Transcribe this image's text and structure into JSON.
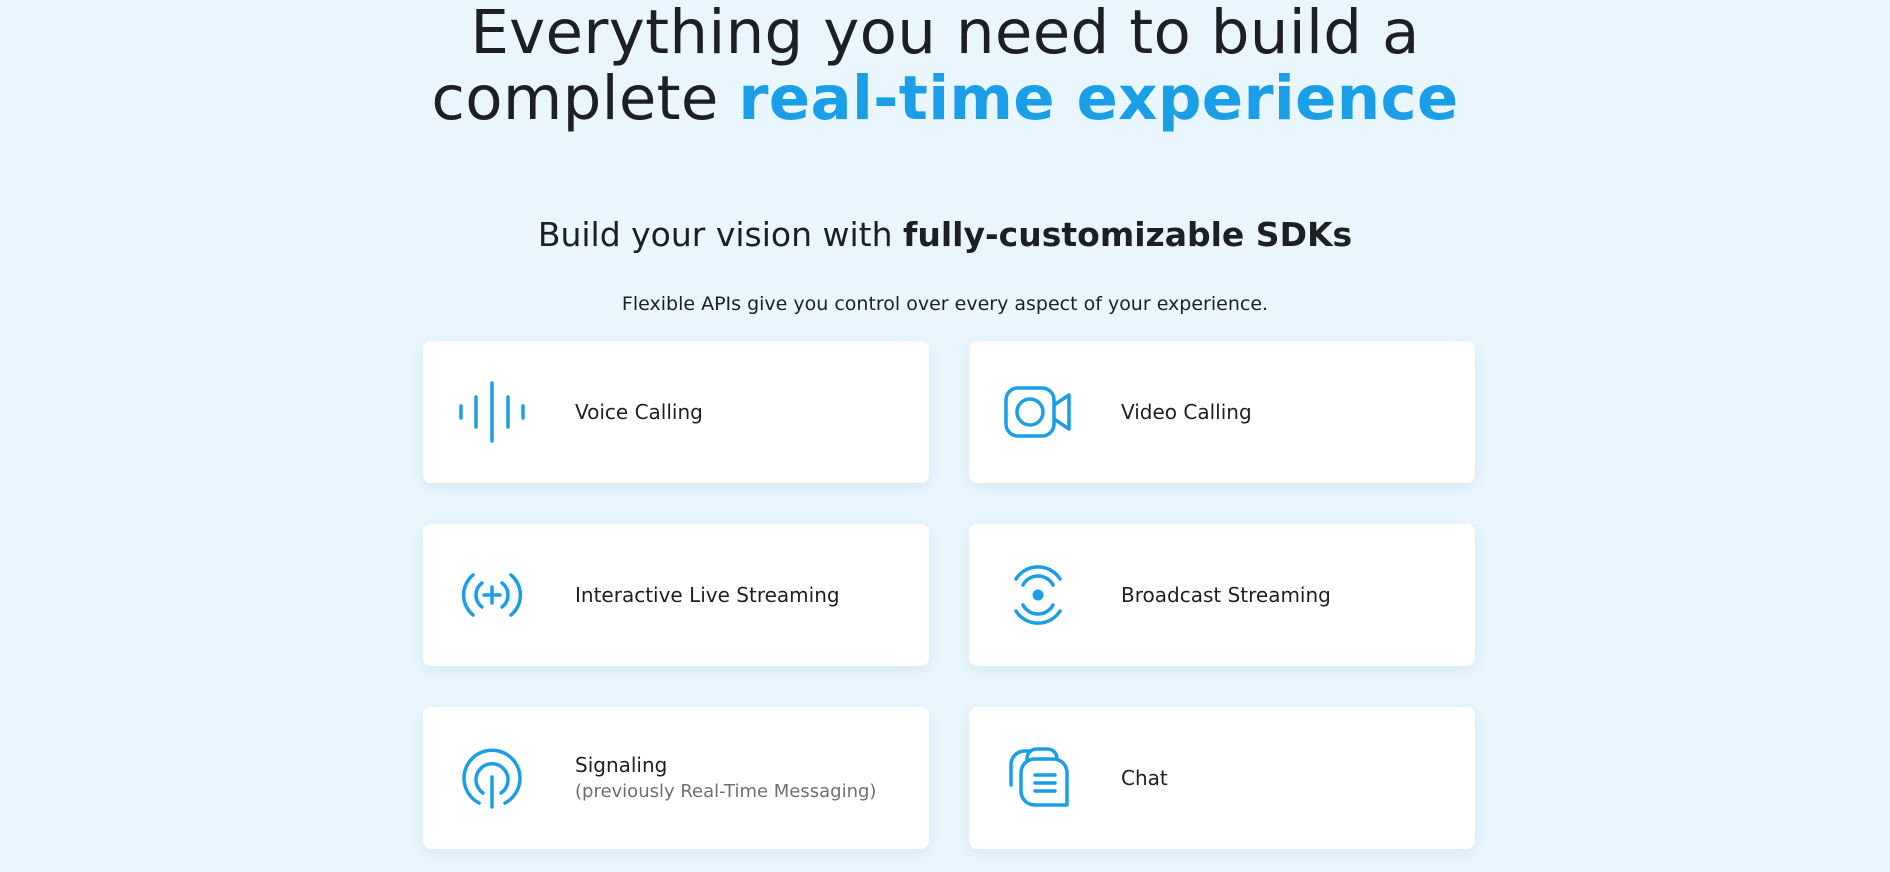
{
  "hero": {
    "line1": "Everything you need to build a",
    "line2_prefix": "complete ",
    "line2_accent": "real-time experience"
  },
  "section": {
    "title_prefix": "Build your vision with ",
    "title_bold": "fully-customizable SDKs",
    "subtitle": "Flexible APIs give you control over every aspect of your experience."
  },
  "products": [
    {
      "label": "Voice Calling",
      "icon": "voice-waveform-icon"
    },
    {
      "label": "Video Calling",
      "icon": "video-camera-icon"
    },
    {
      "label": "Interactive Live Streaming",
      "icon": "live-streaming-icon"
    },
    {
      "label": "Broadcast Streaming",
      "icon": "broadcast-icon"
    },
    {
      "label": "Signaling",
      "sublabel": "(previously Real-Time Messaging)",
      "icon": "signal-antenna-icon"
    },
    {
      "label": "Chat",
      "icon": "chat-bubbles-icon"
    }
  ],
  "colors": {
    "background": "#e9f6fe",
    "accent": "#1a9ee8",
    "text": "#1c1f24",
    "card": "#ffffff"
  }
}
